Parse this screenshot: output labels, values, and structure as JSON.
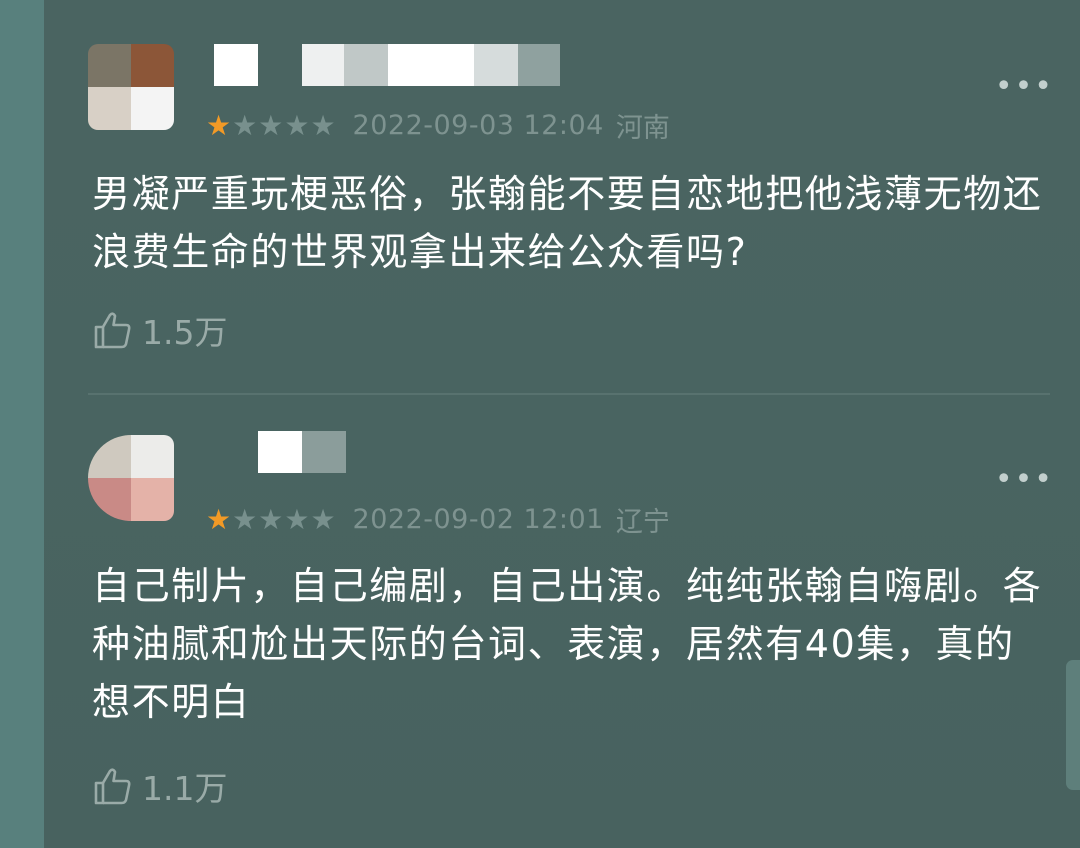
{
  "comments": [
    {
      "rating": 1,
      "max_rating": 5,
      "date": "2022-09-03 12:04",
      "location": "河南",
      "text": "男凝严重玩梗恶俗，张翰能不要自恋地把他浅薄无物还浪费生命的世界观拿出来给公众看吗?",
      "likes": "1.5万",
      "more_icon": "more-dots-icon",
      "like_icon": "thumbs-up-icon"
    },
    {
      "rating": 1,
      "max_rating": 5,
      "date": "2022-09-02 12:01",
      "location": "辽宁",
      "text": "自己制片，自己编剧，自己出演。纯纯张翰自嗨剧。各种油腻和尬出天际的台词、表演，居然有40集，真的想不明白",
      "likes": "1.1万",
      "more_icon": "more-dots-icon",
      "like_icon": "thumbs-up-icon"
    }
  ],
  "colors": {
    "background": "#4a6663",
    "star_on": "#f29a26",
    "star_off": "#78908d",
    "text": "#ffffff",
    "meta": "#7e9390"
  },
  "more_glyph": "•••",
  "star_glyph": "★"
}
